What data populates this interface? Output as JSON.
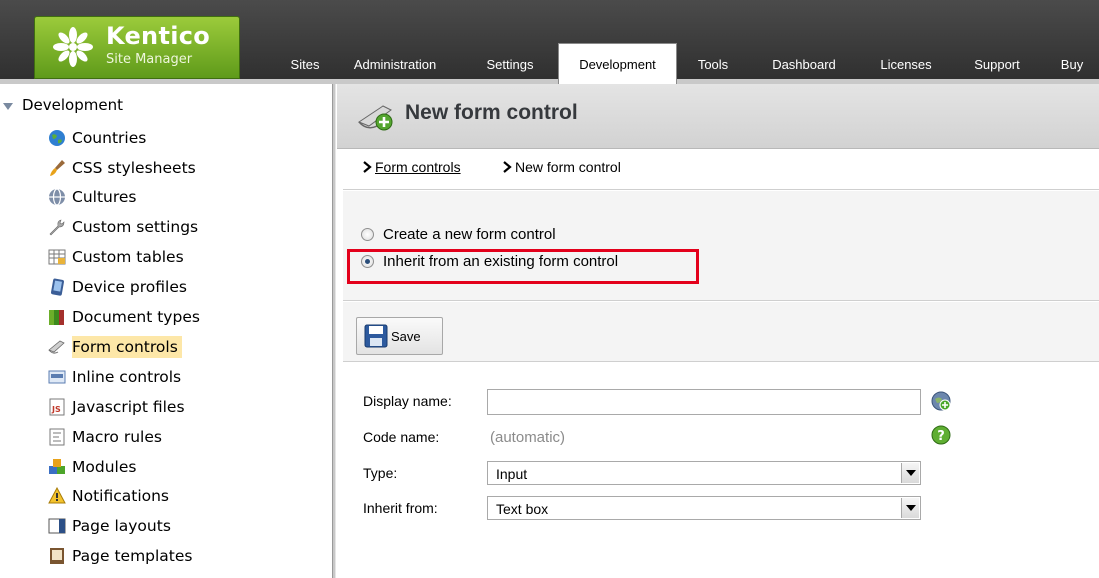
{
  "logo": {
    "title": "Kentico",
    "subtitle": "Site Manager"
  },
  "tabs": [
    {
      "label": "Sites",
      "active": false
    },
    {
      "label": "Administration",
      "active": false
    },
    {
      "label": "Settings",
      "active": false
    },
    {
      "label": "Development",
      "active": true
    },
    {
      "label": "Tools",
      "active": false
    },
    {
      "label": "Dashboard",
      "active": false
    },
    {
      "label": "Licenses",
      "active": false
    },
    {
      "label": "Support",
      "active": false
    },
    {
      "label": "Buy",
      "active": false
    }
  ],
  "sidebar": {
    "root_label": "Development",
    "items": [
      {
        "label": "Countries",
        "icon": "globe-icon"
      },
      {
        "label": "CSS stylesheets",
        "icon": "brush-icon"
      },
      {
        "label": "Cultures",
        "icon": "culture-globe-icon"
      },
      {
        "label": "Custom settings",
        "icon": "wrench-icon"
      },
      {
        "label": "Custom tables",
        "icon": "table-icon"
      },
      {
        "label": "Device profiles",
        "icon": "device-icon"
      },
      {
        "label": "Document types",
        "icon": "books-icon"
      },
      {
        "label": "Form controls",
        "icon": "form-control-icon",
        "selected": true
      },
      {
        "label": "Inline controls",
        "icon": "inline-control-icon"
      },
      {
        "label": "Javascript files",
        "icon": "js-file-icon"
      },
      {
        "label": "Macro rules",
        "icon": "macro-rule-icon"
      },
      {
        "label": "Modules",
        "icon": "modules-icon"
      },
      {
        "label": "Notifications",
        "icon": "notification-icon"
      },
      {
        "label": "Page layouts",
        "icon": "page-layout-icon"
      },
      {
        "label": "Page templates",
        "icon": "page-template-icon"
      }
    ]
  },
  "main": {
    "title": "New form control",
    "breadcrumb": {
      "link": "Form controls",
      "current": "New form control"
    },
    "options": {
      "create_label": "Create a new form control",
      "inherit_label": "Inherit from an existing form control",
      "selected": "inherit"
    },
    "toolbar": {
      "save_label": "Save"
    },
    "form": {
      "display_name_label": "Display name:",
      "display_name_value": "",
      "code_name_label": "Code name:",
      "code_name_value": "(automatic)",
      "type_label": "Type:",
      "type_value": "Input",
      "inherit_label": "Inherit from:",
      "inherit_value": "Text box"
    }
  },
  "colors": {
    "brand_green": "#7fb52c",
    "highlight_red": "#e3001b",
    "selected_bg": "#fde7a8"
  }
}
